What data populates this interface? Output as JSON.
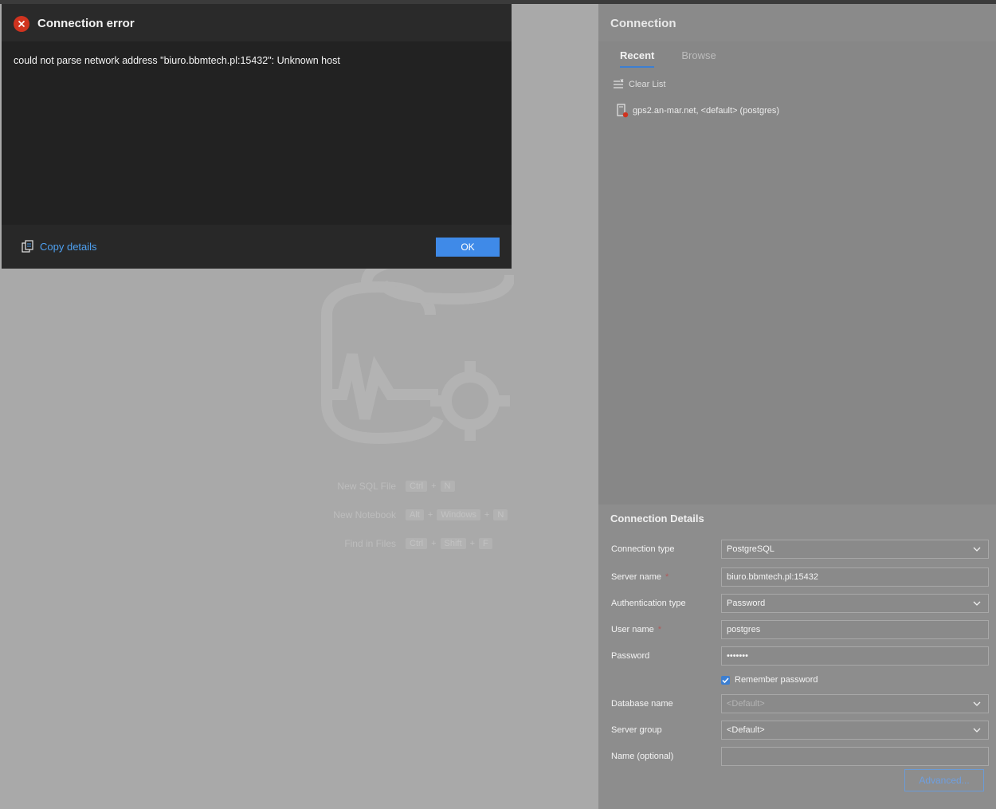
{
  "dialog": {
    "title": "Connection error",
    "message": "could not parse network address \"biuro.bbmtech.pl:15432\": Unknown host",
    "copy_details_label": "Copy details",
    "ok_label": "OK"
  },
  "welcome": {
    "shortcuts": [
      {
        "label": "New SQL File",
        "keys": [
          "Ctrl",
          "N"
        ]
      },
      {
        "label": "New Notebook",
        "keys": [
          "Alt",
          "Windows",
          "N"
        ]
      },
      {
        "label": "Find in Files",
        "keys": [
          "Ctrl",
          "Shift",
          "F"
        ]
      }
    ]
  },
  "connection_panel": {
    "title": "Connection",
    "tabs": [
      {
        "label": "Recent",
        "active": true
      },
      {
        "label": "Browse",
        "active": false
      }
    ],
    "clear_list_label": "Clear List",
    "recent_items": [
      "gps2.an-mar.net, <default> (postgres)"
    ]
  },
  "details": {
    "title": "Connection Details",
    "fields": {
      "connection_type": {
        "label": "Connection type",
        "value": "PostgreSQL"
      },
      "server_name": {
        "label": "Server name",
        "required_mark": "*",
        "value": "biuro.bbmtech.pl:15432"
      },
      "authentication_type": {
        "label": "Authentication type",
        "value": "Password"
      },
      "user_name": {
        "label": "User name",
        "required_mark": "*",
        "value": "postgres"
      },
      "password": {
        "label": "Password",
        "value": "•••••••"
      },
      "remember_password": {
        "label": "Remember password",
        "checked": true
      },
      "database_name": {
        "label": "Database name",
        "value": "<Default>"
      },
      "server_group": {
        "label": "Server group",
        "value": "<Default>"
      },
      "name_optional": {
        "label": "Name (optional)",
        "value": ""
      }
    },
    "advanced_label": "Advanced..."
  },
  "colors": {
    "accent": "#3f8ae8",
    "link": "#4ea0f0",
    "error": "#d0331f"
  }
}
